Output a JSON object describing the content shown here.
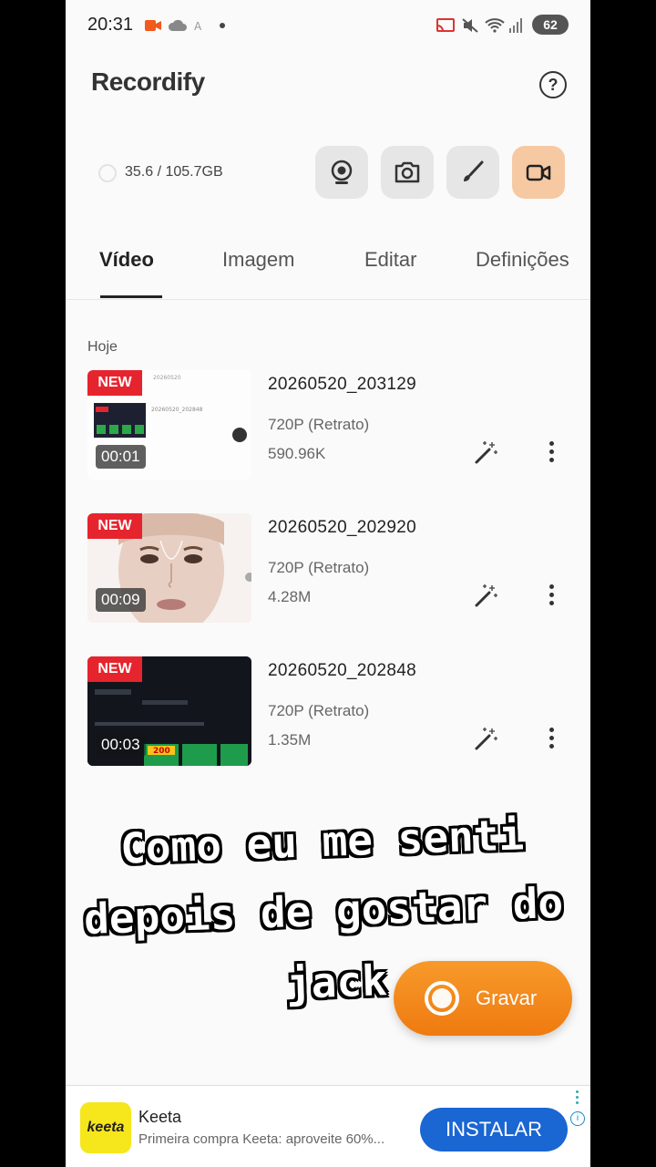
{
  "status_bar": {
    "time": "20:31",
    "battery": "62"
  },
  "app": {
    "title": "Recordify",
    "help_label": "?"
  },
  "storage": {
    "text": "35.6 / 105.7GB"
  },
  "tabs": [
    {
      "label": "Vídeo",
      "active": true
    },
    {
      "label": "Imagem",
      "active": false
    },
    {
      "label": "Editar",
      "active": false
    },
    {
      "label": "Definições",
      "active": false
    }
  ],
  "section": {
    "label": "Hoje"
  },
  "recordings": [
    {
      "badge": "NEW",
      "duration": "00:01",
      "name": "20260520_203129",
      "resolution": "720P (Retrato)",
      "size": "590.96K"
    },
    {
      "badge": "NEW",
      "duration": "00:09",
      "name": "20260520_202920",
      "resolution": "720P (Retrato)",
      "size": "4.28M"
    },
    {
      "badge": "NEW",
      "duration": "00:03",
      "name": "20260520_202848",
      "resolution": "720P (Retrato)",
      "size": "1.35M"
    }
  ],
  "overlay_text": {
    "line1": "Como eu me senti",
    "line2": "depois de gostar do",
    "line3": "jack"
  },
  "record_button": {
    "label": "Gravar"
  },
  "ad": {
    "logo_text": "keeta",
    "title": "Keeta",
    "description": "Primeira compra Keeta: aproveite 60%...",
    "install_label": "INSTALAR",
    "info_label": "i"
  },
  "colors": {
    "accent_orange": "#ef7a10",
    "new_badge": "#e6242e",
    "install_blue": "#1a66d2"
  }
}
